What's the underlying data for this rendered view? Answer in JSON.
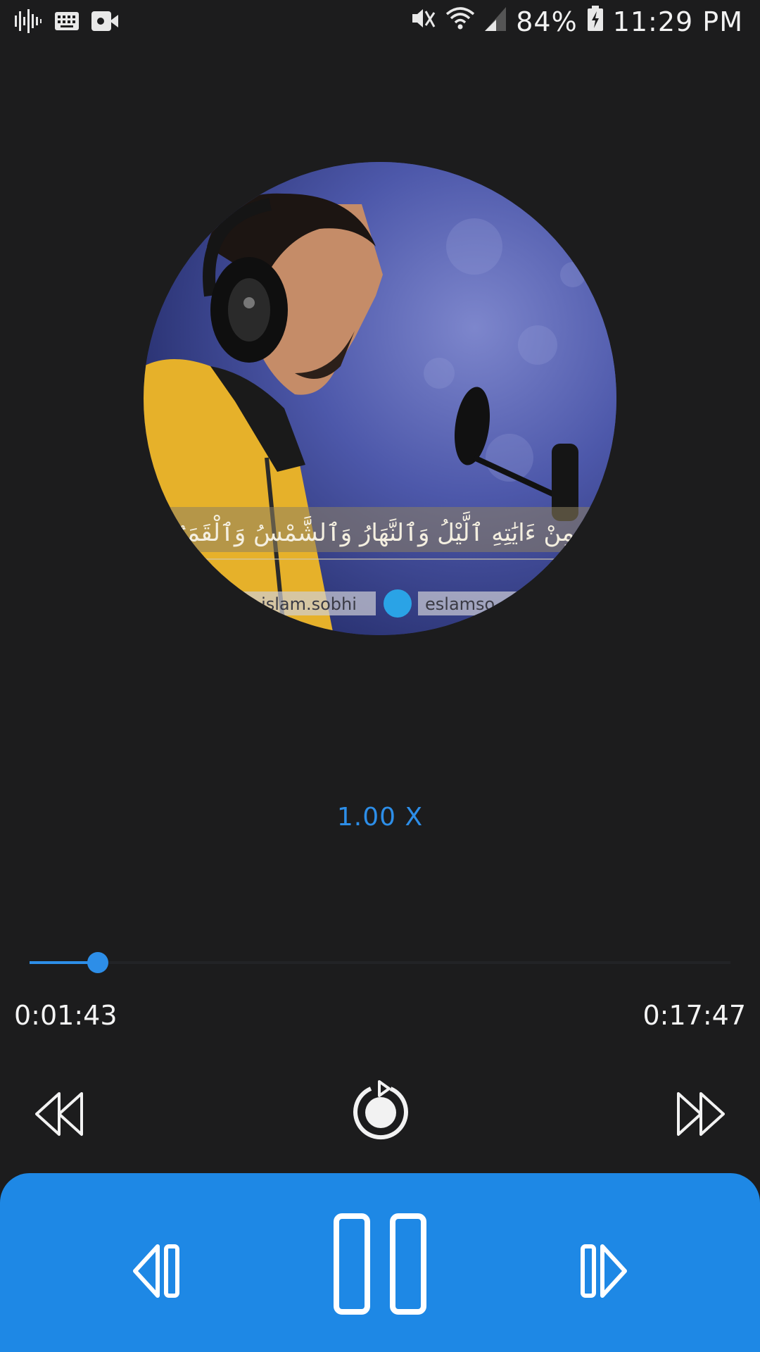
{
  "status_bar": {
    "battery_percent": "84%",
    "time": "11:29 PM",
    "left_icons": [
      "audio-wave-icon",
      "keyboard-icon",
      "video-camera-icon"
    ],
    "right_icons": [
      "mute-icon",
      "wifi-icon",
      "signal-icon",
      "battery-charging-icon"
    ]
  },
  "artwork": {
    "overlay_arabic": "وَمِنْ ءَايَٰتِهِ ٱلَّيْلُ وَٱلنَّهَارُ وَٱلشَّمْسُ وَٱلْقَمَرُ",
    "handle_left": "islam.sobhi",
    "handle_right": "eslamso"
  },
  "playback": {
    "speed": "1.00 X",
    "elapsed": "0:01:43",
    "total": "0:17:47",
    "progress_fraction": 0.097
  },
  "colors": {
    "accent": "#1e88e5",
    "background": "#1c1c1d",
    "text": "#f2f2f2"
  },
  "controls": {
    "rewind_icon": "rewind-icon",
    "repeat_icon": "repeat-icon",
    "fast_forward_icon": "fast-forward-icon",
    "previous_icon": "skip-previous-icon",
    "pause_icon": "pause-icon",
    "next_icon": "skip-next-icon"
  }
}
